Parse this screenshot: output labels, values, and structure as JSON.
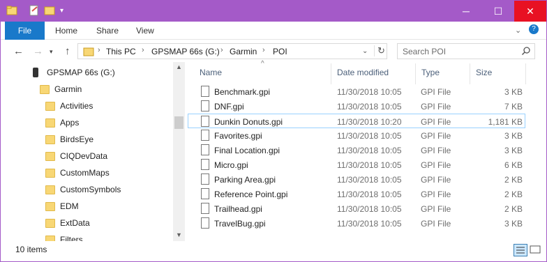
{
  "ribbon": {
    "tabs": [
      "File",
      "Home",
      "Share",
      "View"
    ]
  },
  "address": {
    "segments": [
      "This PC",
      "GPSMAP 66s (G:)",
      "Garmin",
      "POI"
    ]
  },
  "search": {
    "placeholder": "Search POI"
  },
  "nav_pane": {
    "drive": "GPSMAP 66s (G:)",
    "root_folder": "Garmin",
    "folders": [
      "Activities",
      "Apps",
      "BirdsEye",
      "CIQDevData",
      "CustomMaps",
      "CustomSymbols",
      "EDM",
      "ExtData",
      "Filters"
    ]
  },
  "columns": {
    "name": "Name",
    "date": "Date modified",
    "type": "Type",
    "size": "Size"
  },
  "files": [
    {
      "name": "Benchmark.gpi",
      "date": "11/30/2018 10:05",
      "type": "GPI File",
      "size": "3 KB"
    },
    {
      "name": "DNF.gpi",
      "date": "11/30/2018 10:05",
      "type": "GPI File",
      "size": "7 KB"
    },
    {
      "name": "Dunkin Donuts.gpi",
      "date": "11/30/2018 10:20",
      "type": "GPI File",
      "size": "1,181 KB"
    },
    {
      "name": "Favorites.gpi",
      "date": "11/30/2018 10:05",
      "type": "GPI File",
      "size": "3 KB"
    },
    {
      "name": "Final Location.gpi",
      "date": "11/30/2018 10:05",
      "type": "GPI File",
      "size": "3 KB"
    },
    {
      "name": "Micro.gpi",
      "date": "11/30/2018 10:05",
      "type": "GPI File",
      "size": "6 KB"
    },
    {
      "name": "Parking Area.gpi",
      "date": "11/30/2018 10:05",
      "type": "GPI File",
      "size": "2 KB"
    },
    {
      "name": "Reference Point.gpi",
      "date": "11/30/2018 10:05",
      "type": "GPI File",
      "size": "2 KB"
    },
    {
      "name": "Trailhead.gpi",
      "date": "11/30/2018 10:05",
      "type": "GPI File",
      "size": "2 KB"
    },
    {
      "name": "TravelBug.gpi",
      "date": "11/30/2018 10:05",
      "type": "GPI File",
      "size": "3 KB"
    }
  ],
  "status": {
    "item_count": "10 items"
  },
  "colors": {
    "titlebar": "#a45ac8",
    "file_tab": "#1979ca",
    "selection": "#99d1ff",
    "close": "#e81123"
  }
}
